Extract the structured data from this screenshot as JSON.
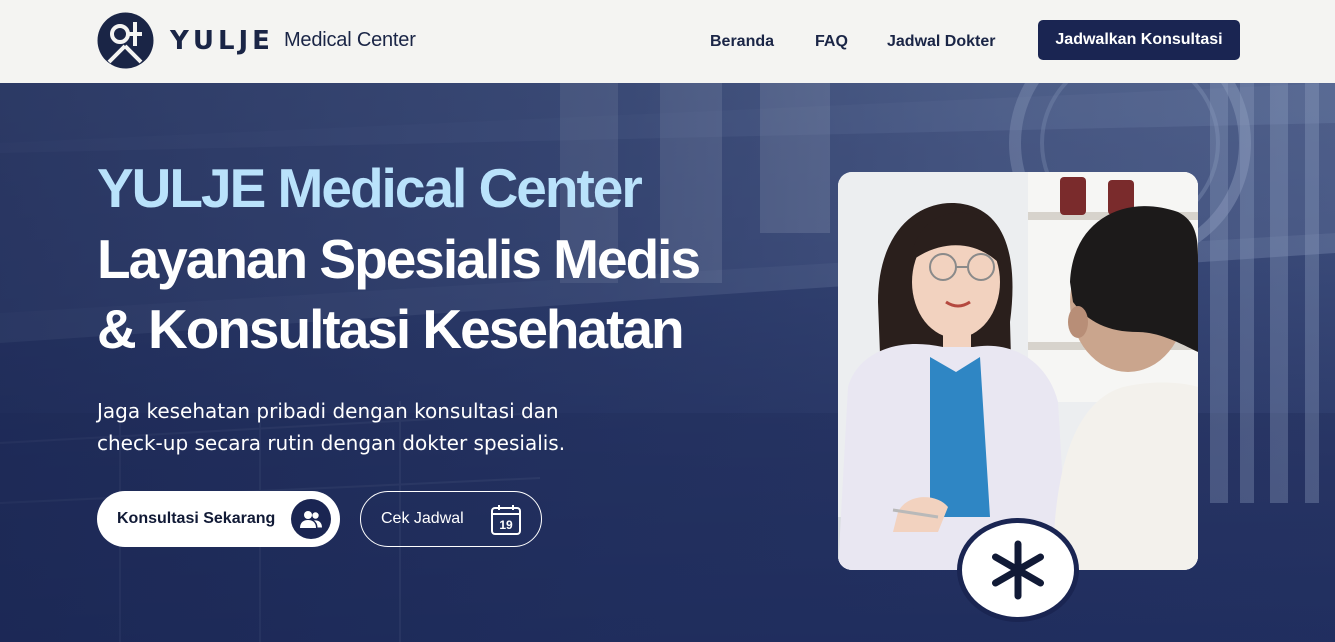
{
  "header": {
    "logo_word": "YULJE",
    "logo_sub": "Medical Center",
    "nav": [
      {
        "label": "Beranda"
      },
      {
        "label": "FAQ"
      },
      {
        "label": "Jadwal Dokter"
      }
    ],
    "cta_label": "Jadwalkan Konsultasi"
  },
  "hero": {
    "title_line1": "YULJE Medical Center",
    "title_line2": "Layanan Spesialis Medis",
    "title_line3": "& Konsultasi Kesehatan",
    "subtitle_line1": "Jaga kesehatan pribadi dengan konsultasi dan",
    "subtitle_line2": "check-up secara rutin dengan dokter spesialis.",
    "primary_button": {
      "label": "Konsultasi Sekarang",
      "icon": "users-icon"
    },
    "secondary_button": {
      "label": "Cek Jadwal",
      "icon": "calendar-icon",
      "calendar_day": "19"
    },
    "badge_icon": "asterisk-icon"
  },
  "colors": {
    "navy": "#1a2552",
    "accent_light_blue": "#b9e2fb",
    "header_bg": "#f4f4f2"
  }
}
